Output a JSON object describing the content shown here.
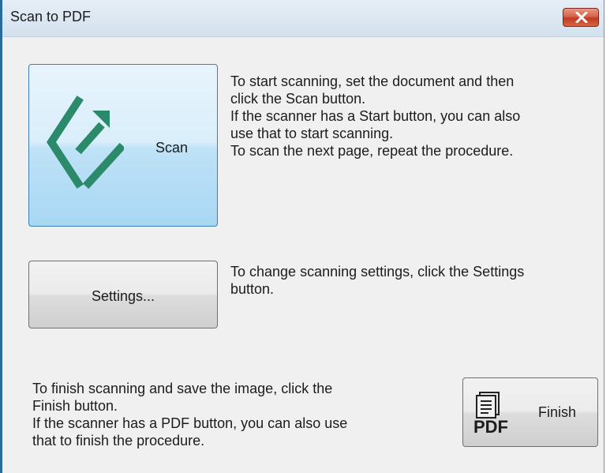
{
  "window": {
    "title": "Scan to PDF"
  },
  "scan": {
    "label": "Scan",
    "description": "To start scanning, set the document and then\nclick the Scan button.\nIf the scanner has a Start button, you can also\nuse that to start scanning.\nTo scan the next page, repeat the procedure."
  },
  "settings": {
    "label": "Settings...",
    "description": "To change scanning settings, click the Settings\nbutton."
  },
  "finish": {
    "label": "Finish",
    "icon_text": "PDF",
    "description": "To finish scanning and save the image, click the\nFinish button.\nIf the scanner has a PDF button, you can also use\nthat to finish the procedure."
  },
  "icons": {
    "close": "close-icon",
    "scan": "scan-arrow-icon",
    "finish": "pdf-document-icon"
  },
  "colors": {
    "scan_icon": "#2b8a6a",
    "scan_button_top": "#e8f4fc",
    "scan_button_bottom": "#a8d7f3",
    "close_button": "#c9452e"
  }
}
